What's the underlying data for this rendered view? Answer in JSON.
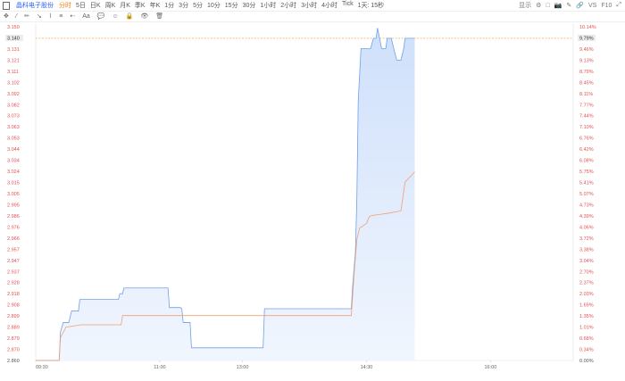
{
  "topbar": {
    "stock_name": "晶科电子股份",
    "intervals": [
      "分时",
      "5日",
      "日K",
      "周K",
      "月K",
      "季K",
      "年K",
      "1分",
      "3分",
      "5分",
      "10分",
      "15分",
      "30分",
      "1小时",
      "2小时",
      "3小时",
      "4小时",
      "Tick",
      "1天: 15秒"
    ],
    "active_interval": "分时",
    "right_items": [
      "显示",
      "⚙",
      "□",
      "📷",
      "✎",
      "🔗",
      "VS",
      "F10",
      "⤢"
    ]
  },
  "toolbar": {
    "tools": [
      "✥",
      "⁄",
      "✏",
      "↘",
      "⌇",
      "≡",
      "⇠",
      "Aa",
      "💬",
      "☺",
      "🔒",
      "👁",
      "🗑"
    ]
  },
  "chart_data": {
    "type": "area",
    "title": "",
    "xlabel": "",
    "ylabel": "",
    "ylim": [
      2.86,
      3.15
    ],
    "yticks_left": [
      "3.150",
      "3.140",
      "3.131",
      "3.121",
      "3.111",
      "3.102",
      "3.092",
      "3.082",
      "3.073",
      "3.063",
      "3.053",
      "3.044",
      "3.034",
      "3.024",
      "3.015",
      "3.005",
      "2.995",
      "2.986",
      "2.976",
      "2.966",
      "2.957",
      "2.947",
      "2.937",
      "2.928",
      "2.918",
      "2.908",
      "2.899",
      "2.889",
      "2.879",
      "2.870",
      "2.860"
    ],
    "yticks_right": [
      "10.14%",
      "9.79%",
      "9.46%",
      "9.13%",
      "8.79%",
      "8.45%",
      "8.11%",
      "7.77%",
      "7.44%",
      "7.10%",
      "6.76%",
      "6.42%",
      "6.08%",
      "5.75%",
      "5.41%",
      "5.07%",
      "4.73%",
      "4.39%",
      "4.06%",
      "3.72%",
      "3.38%",
      "3.04%",
      "2.70%",
      "2.37%",
      "2.03%",
      "1.69%",
      "1.35%",
      "1.01%",
      "0.68%",
      "0.34%",
      "0.00%"
    ],
    "highlight_price": "3.140",
    "highlight_pct": "9.79%",
    "xticks": [
      "09:30",
      "11:00",
      "13:00",
      "14:30",
      "16:00"
    ],
    "x_range_minutes": [
      0,
      390
    ],
    "xtick_minutes": [
      0,
      90,
      150,
      240,
      330
    ],
    "series": [
      {
        "type": "price",
        "points": [
          [
            0,
            2.86
          ],
          [
            17,
            2.86
          ],
          [
            18,
            2.885
          ],
          [
            20,
            2.893
          ],
          [
            24,
            2.893
          ],
          [
            26,
            2.903
          ],
          [
            31,
            2.903
          ],
          [
            32,
            2.913
          ],
          [
            60,
            2.913
          ],
          [
            61,
            2.918
          ],
          [
            63,
            2.918
          ],
          [
            64,
            2.923
          ],
          [
            96,
            2.923
          ],
          [
            97,
            2.906
          ],
          [
            105,
            2.906
          ],
          [
            106,
            2.905
          ],
          [
            107,
            2.893
          ],
          [
            112,
            2.893
          ],
          [
            113,
            2.871
          ],
          [
            165,
            2.871
          ],
          [
            166,
            2.905
          ],
          [
            229,
            2.905
          ],
          [
            230,
            2.925
          ],
          [
            232,
            2.955
          ],
          [
            233,
            3.0
          ],
          [
            234,
            3.085
          ],
          [
            236,
            3.131
          ],
          [
            243,
            3.131
          ],
          [
            245,
            3.14
          ],
          [
            247,
            3.14
          ],
          [
            248,
            3.149
          ],
          [
            251,
            3.131
          ],
          [
            254,
            3.131
          ],
          [
            255,
            3.14
          ],
          [
            258,
            3.14
          ],
          [
            260,
            3.13
          ],
          [
            262,
            3.121
          ],
          [
            265,
            3.121
          ],
          [
            267,
            3.131
          ],
          [
            268,
            3.14
          ],
          [
            275,
            3.14
          ]
        ]
      },
      {
        "type": "average",
        "points": [
          [
            0,
            2.86
          ],
          [
            17,
            2.86
          ],
          [
            18,
            2.88
          ],
          [
            22,
            2.889
          ],
          [
            33,
            2.891
          ],
          [
            62,
            2.891
          ],
          [
            63,
            2.899
          ],
          [
            166,
            2.899
          ],
          [
            229,
            2.899
          ],
          [
            231,
            2.935
          ],
          [
            233,
            2.965
          ],
          [
            235,
            2.975
          ],
          [
            240,
            2.979
          ],
          [
            242,
            2.985
          ],
          [
            244,
            2.986
          ],
          [
            250,
            2.987
          ],
          [
            256,
            2.988
          ],
          [
            265,
            2.99
          ],
          [
            268,
            3.015
          ],
          [
            272,
            3.02
          ],
          [
            275,
            3.024
          ]
        ]
      }
    ]
  },
  "bottombar": {
    "labels": [
      "—",
      "—",
      "—",
      "—",
      "—"
    ]
  }
}
